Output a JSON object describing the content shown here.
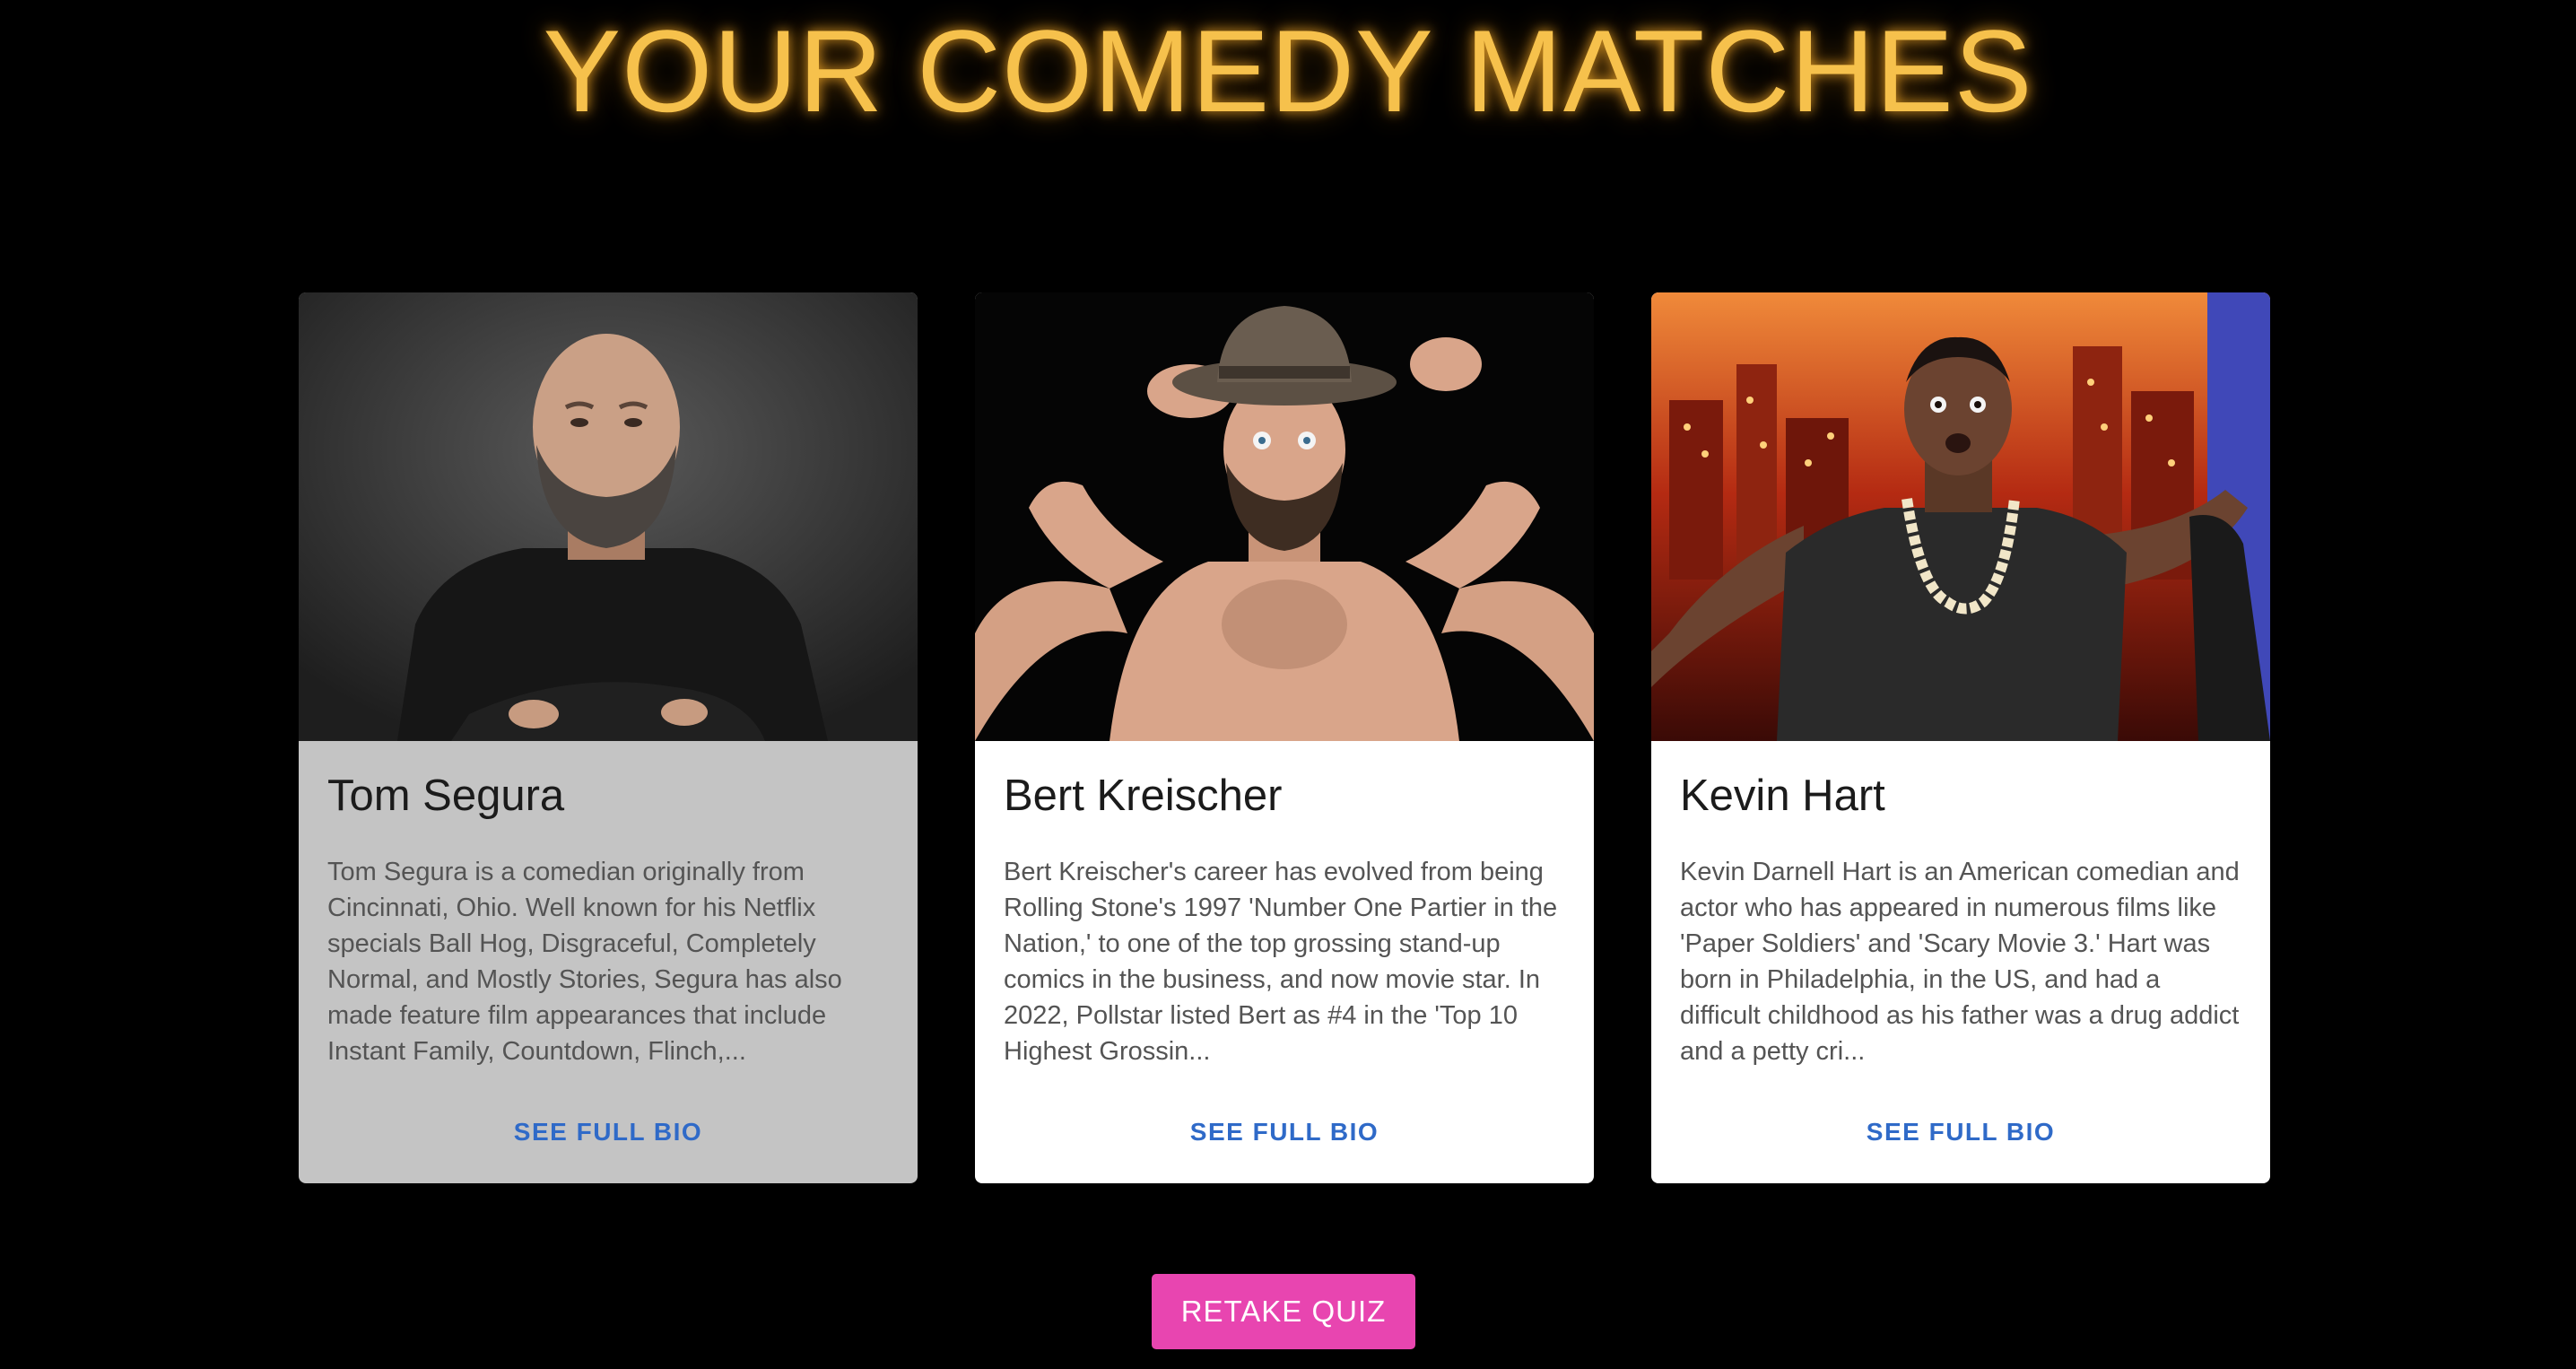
{
  "page": {
    "title": "YOUR COMEDY MATCHES",
    "title_color": "#f6c14c",
    "background_color": "#000000"
  },
  "matches": [
    {
      "name": "Tom Segura",
      "bio": "Tom Segura is a comedian originally from Cincinnati, Ohio. Well known for his Netflix specials Ball Hog, Disgraceful, Completely Normal, and Mostly Stories, Segura has also made feature film appearances that include Instant Family, Countdown, Flinch,...",
      "button_label": "SEE FULL BIO",
      "card_color": "#c4c4c4",
      "photo_icon": "comedian-photo"
    },
    {
      "name": "Bert Kreischer",
      "bio": "Bert Kreischer's career has evolved from being Rolling Stone's 1997 'Number One Partier in the Nation,' to one of the top grossing stand-up comics in the business, and now movie star. In 2022, Pollstar listed Bert as #4 in the 'Top 10 Highest Grossin...",
      "button_label": "SEE FULL BIO",
      "card_color": "#ffffff",
      "photo_icon": "comedian-photo"
    },
    {
      "name": "Kevin Hart",
      "bio": "Kevin Darnell Hart is an American comedian and actor who has appeared in numerous films like 'Paper Soldiers' and 'Scary Movie 3.' Hart was born in Philadelphia, in the US, and had a difficult childhood as his father was a drug addict and a petty cri...",
      "button_label": "SEE FULL BIO",
      "card_color": "#ffffff",
      "photo_icon": "comedian-photo"
    }
  ],
  "retake": {
    "label": "RETAKE QUIZ",
    "color": "#e845b0"
  },
  "accent_link_color": "#2f6ac8"
}
